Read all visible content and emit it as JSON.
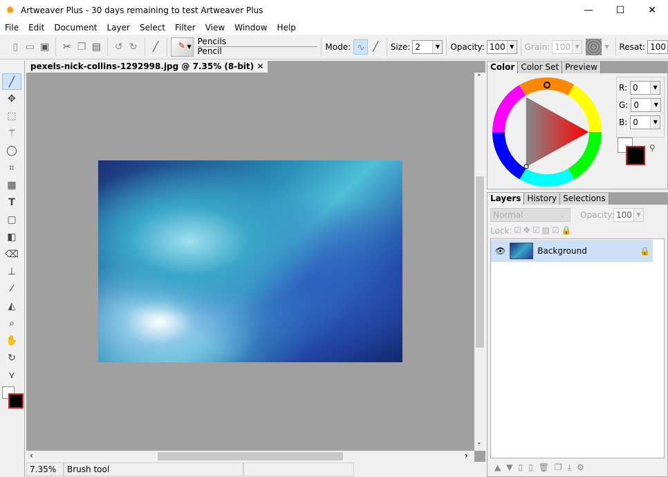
{
  "window": {
    "title": "Artweaver Plus - 30 days remaining to test Artweaver Plus",
    "minimize": "—",
    "maximize": "☐",
    "close": "✕"
  },
  "menu": [
    "File",
    "Edit",
    "Document",
    "Layer",
    "Select",
    "Filter",
    "View",
    "Window",
    "Help"
  ],
  "toolbar": {
    "brush_category": "Pencils",
    "brush_variant": "Pencil",
    "mode_label": "Mode:",
    "size_label": "Size:",
    "size_value": "2",
    "opacity_label": "Opacity:",
    "opacity_value": "100",
    "grain_label": "Grain:",
    "grain_value": "100",
    "resat_label": "Resat:",
    "resat_value": "100"
  },
  "document": {
    "tab_title": "pexels-nick-collins-1292998.jpg @ 7.35% (8-bit)",
    "close": "✕"
  },
  "status": {
    "zoom": "7.35%",
    "tool": "Brush tool"
  },
  "color_panel": {
    "tabs": [
      "Color",
      "Color Set",
      "Preview"
    ],
    "r_label": "R:",
    "r": "0",
    "g_label": "G:",
    "g": "0",
    "b_label": "B:",
    "b": "0",
    "foreground": "#000000",
    "background": "#ffffff"
  },
  "layers_panel": {
    "tabs": [
      "Layers",
      "History",
      "Selections"
    ],
    "blend_mode": "Normal",
    "opacity_label": "Opacity:",
    "opacity_value": "100",
    "lock_label": "Lock:",
    "layers": [
      {
        "name": "Background",
        "visible": true,
        "locked": true
      }
    ]
  },
  "colors": {
    "accent": "#cde3f7",
    "canvas_bg": "#a0a0a0"
  }
}
